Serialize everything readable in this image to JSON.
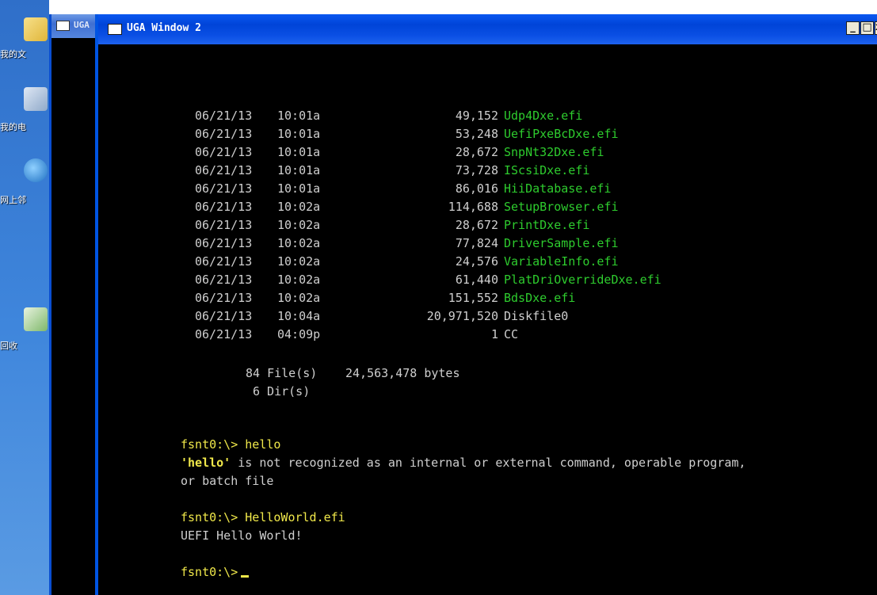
{
  "desktop": {
    "icons": [
      {
        "label": "我的文",
        "icon": "folder-icon"
      },
      {
        "label": "我的电",
        "icon": "computer-icon"
      },
      {
        "label": "网上邻",
        "icon": "network-icon"
      },
      {
        "label": "回收",
        "icon": "recycle-bin-icon"
      }
    ]
  },
  "windows": {
    "background_title": "UGA",
    "main_title": "UGA Window 2",
    "controls": {
      "minimize": "_",
      "restore": "□",
      "close": "x"
    }
  },
  "console": {
    "files": [
      {
        "date": "06/21/13",
        "time": "10:01a",
        "size": "49,152",
        "name": "Udp4Dxe.efi"
      },
      {
        "date": "06/21/13",
        "time": "10:01a",
        "size": "53,248",
        "name": "UefiPxeBcDxe.efi"
      },
      {
        "date": "06/21/13",
        "time": "10:01a",
        "size": "28,672",
        "name": "SnpNt32Dxe.efi"
      },
      {
        "date": "06/21/13",
        "time": "10:01a",
        "size": "73,728",
        "name": "IScsiDxe.efi"
      },
      {
        "date": "06/21/13",
        "time": "10:01a",
        "size": "86,016",
        "name": "HiiDatabase.efi"
      },
      {
        "date": "06/21/13",
        "time": "10:02a",
        "size": "114,688",
        "name": "SetupBrowser.efi"
      },
      {
        "date": "06/21/13",
        "time": "10:02a",
        "size": "28,672",
        "name": "PrintDxe.efi"
      },
      {
        "date": "06/21/13",
        "time": "10:02a",
        "size": "77,824",
        "name": "DriverSample.efi"
      },
      {
        "date": "06/21/13",
        "time": "10:02a",
        "size": "24,576",
        "name": "VariableInfo.efi"
      },
      {
        "date": "06/21/13",
        "time": "10:02a",
        "size": "61,440",
        "name": "PlatDriOverrideDxe.efi"
      },
      {
        "date": "06/21/13",
        "time": "10:02a",
        "size": "151,552",
        "name": "BdsDxe.efi"
      },
      {
        "date": "06/21/13",
        "time": "10:04a",
        "size": "20,971,520",
        "name": "Diskfile0",
        "plain": true
      },
      {
        "date": "06/21/13",
        "time": "04:09p",
        "size": "1",
        "name": "CC",
        "plain": true
      }
    ],
    "summary_files": "84 File(s)",
    "summary_bytes": "24,563,478 bytes",
    "summary_dirs": "6 Dir(s)",
    "prompt": "fsnt0:\\>",
    "cmd1": "hello",
    "err_word": "'hello'",
    "err_rest": " is not recognized as an internal or external command, operable program,",
    "err_line2": "or batch file",
    "cmd2": "HelloWorld.efi",
    "output2": "UEFI Hello World!"
  },
  "colors": {
    "file_green": "#2ecc2e",
    "prompt_yellow": "#f0e84a",
    "titlebar_blue": "#0054e3"
  }
}
